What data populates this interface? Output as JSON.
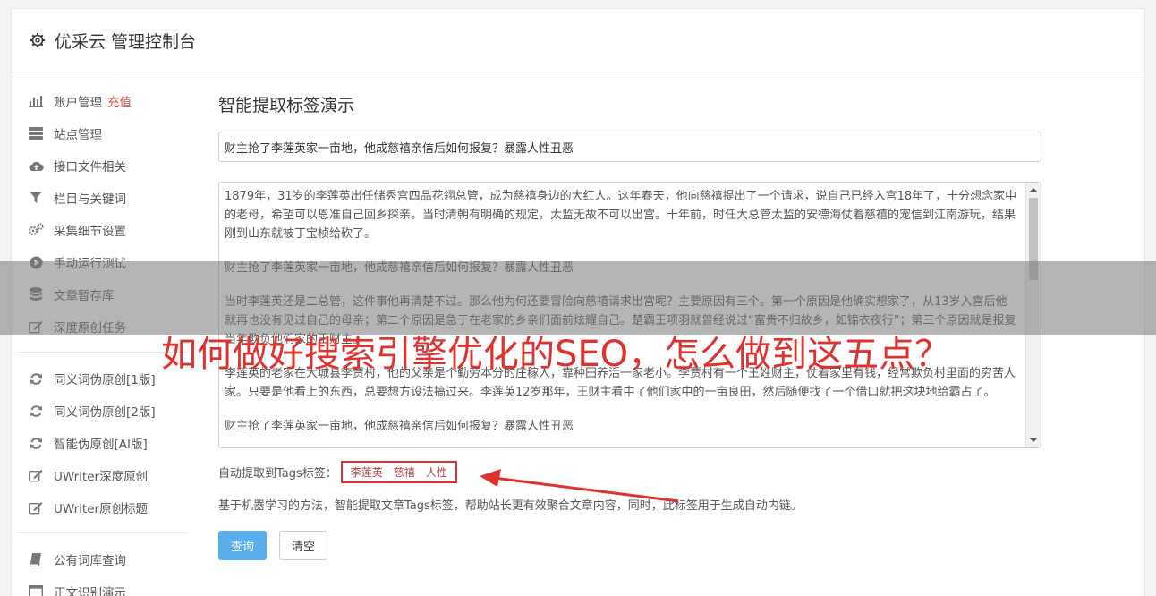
{
  "header": {
    "title": "优采云 管理控制台"
  },
  "sidebar": {
    "group1": [
      {
        "label": "账户管理",
        "highlight": "充值",
        "icon": "bar-chart-icon"
      },
      {
        "label": "站点管理",
        "icon": "server-icon"
      },
      {
        "label": "接口文件相关",
        "icon": "cloud-upload-icon"
      },
      {
        "label": "栏目与关键词",
        "icon": "filter-icon"
      },
      {
        "label": "采集细节设置",
        "icon": "gears-icon"
      },
      {
        "label": "手动运行测试",
        "icon": "play-icon"
      },
      {
        "label": "文章暂存库",
        "icon": "database-icon"
      },
      {
        "label": "深度原创任务",
        "icon": "edit-icon"
      }
    ],
    "group2": [
      {
        "label": "同义词伪原创[1版]",
        "icon": "refresh-icon"
      },
      {
        "label": "同义词伪原创[2版]",
        "icon": "refresh-icon"
      },
      {
        "label": "智能伪原创[AI版]",
        "icon": "refresh-icon"
      },
      {
        "label": "UWriter深度原创",
        "icon": "edit-icon"
      },
      {
        "label": "UWriter原创标题",
        "icon": "edit-icon"
      }
    ],
    "group3": [
      {
        "label": "公有词库查询",
        "icon": "book-icon"
      },
      {
        "label": "正文识别演示",
        "icon": "window-icon"
      }
    ]
  },
  "main": {
    "heading": "智能提取标签演示",
    "title_value": "财主抢了李莲英家一亩地，他成慈禧亲信后如何报复？暴露人性丑恶",
    "paragraphs": [
      "1879年，31岁的李莲英出任储秀宫四品花翎总管，成为慈禧身边的大红人。这年春天，他向慈禧提出了一个请求，说自己已经入宫18年了，十分想念家中的老母，希望可以恩准自己回乡探亲。当时清朝有明确的规定，太监无故不可以出宫。十年前，时任大总管太监的安德海仗着慈禧的宠信到江南游玩，结果刚到山东就被丁宝桢给砍了。",
      "财主抢了李莲英家一亩地，他成慈禧亲信后如何报复？暴露人性丑恶",
      "当时李莲英还是二总管，这件事他再清楚不过。那么他为何还要冒险向慈禧请求出宫呢？主要原因有三个。第一个原因是他确实想家了，从13岁入宫后他就再也没有见过自己的母亲；第二个原因是急于在老家的乡亲们面前炫耀自己。楚霸王项羽就曾经说过“富贵不归故乡，如锦衣夜行”；第三个原因就是报复当年欺负他们家的王财主。",
      "李莲英的老家在大城县李贾村，他的父亲是个勤劳本分的庄稼人，靠种田养活一家老小。李贾村有一个王姓财主，仗着家里有钱，经常欺负村里面的穷苦人家。只要是他看上的东西，总要想方设法搞过来。李莲英12岁那年，王财主看中了他们家中的一亩良田，然后随便找了一个借口就把这块地给霸占了。",
      "财主抢了李莲英家一亩地，他成慈禧亲信后如何报复？暴露人性丑恶"
    ],
    "tags_label": "自动提取到Tags标签：",
    "tags": [
      "李莲英",
      "慈禧",
      "人性"
    ],
    "description": "基于机器学习的方法，智能提取文章Tags标签，帮助站长更有效聚合文章内容，同时，此标签用于生成自动内链。",
    "query_button": "查询",
    "clear_button": "清空"
  },
  "overlay": {
    "headline": "如何做好搜索引擎优化的SEO，怎么做到这五点？"
  },
  "colors": {
    "accent_red": "#e0312f",
    "primary_blue": "#5aaeeb"
  }
}
